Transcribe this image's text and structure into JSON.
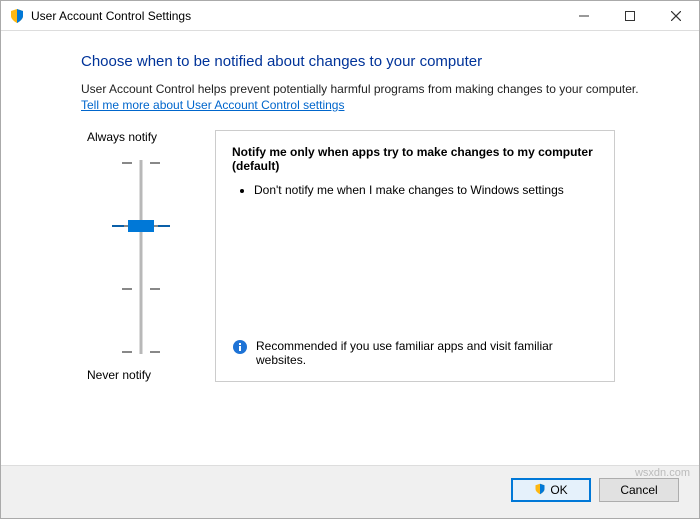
{
  "window": {
    "title": "User Account Control Settings"
  },
  "heading": "Choose when to be notified about changes to your computer",
  "subtext": "User Account Control helps prevent potentially harmful programs from making changes to your computer.",
  "link": "Tell me more about User Account Control settings",
  "slider": {
    "top_label": "Always notify",
    "bottom_label": "Never notify"
  },
  "description": {
    "title": "Notify me only when apps try to make changes to my computer (default)",
    "bullet1": "Don't notify me when I make changes to Windows settings",
    "recommend": "Recommended if you use familiar apps and visit familiar websites."
  },
  "buttons": {
    "ok": "OK",
    "cancel": "Cancel"
  },
  "watermark": "wsxdn.com"
}
